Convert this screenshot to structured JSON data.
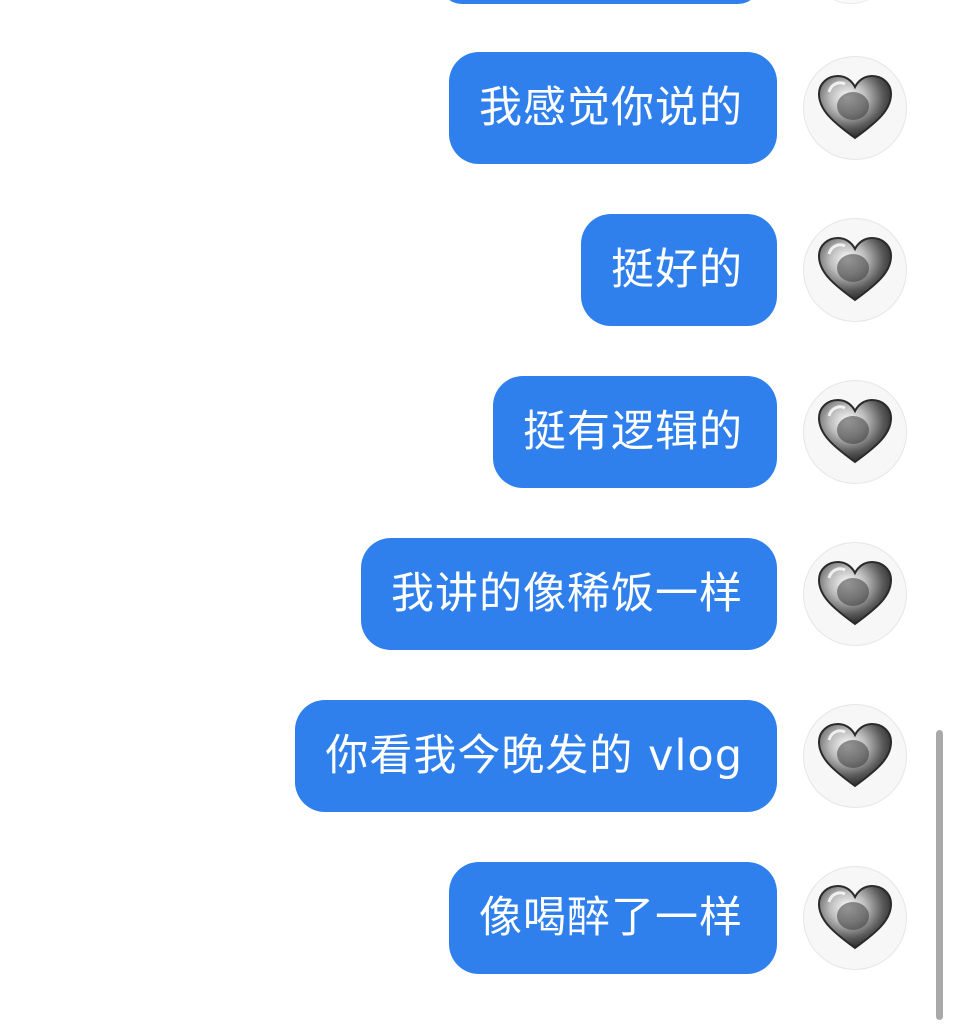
{
  "chat": {
    "messages": [
      {
        "text": "我感觉你说的",
        "sender": "self",
        "avatar_icon": "silver-heart-icon"
      },
      {
        "text": "挺好的",
        "sender": "self",
        "avatar_icon": "silver-heart-icon"
      },
      {
        "text": "挺有逻辑的",
        "sender": "self",
        "avatar_icon": "silver-heart-icon"
      },
      {
        "text": "我讲的像稀饭一样",
        "sender": "self",
        "avatar_icon": "silver-heart-icon"
      },
      {
        "text": "你看我今晚发的 vlog",
        "sender": "self",
        "avatar_icon": "silver-heart-icon"
      },
      {
        "text": "像喝醉了一样",
        "sender": "self",
        "avatar_icon": "silver-heart-icon"
      }
    ]
  },
  "colors": {
    "bubble": "#2f80ed",
    "bubble_text": "#ffffff",
    "background": "#ffffff",
    "scrollbar": "#a9a9a9"
  }
}
